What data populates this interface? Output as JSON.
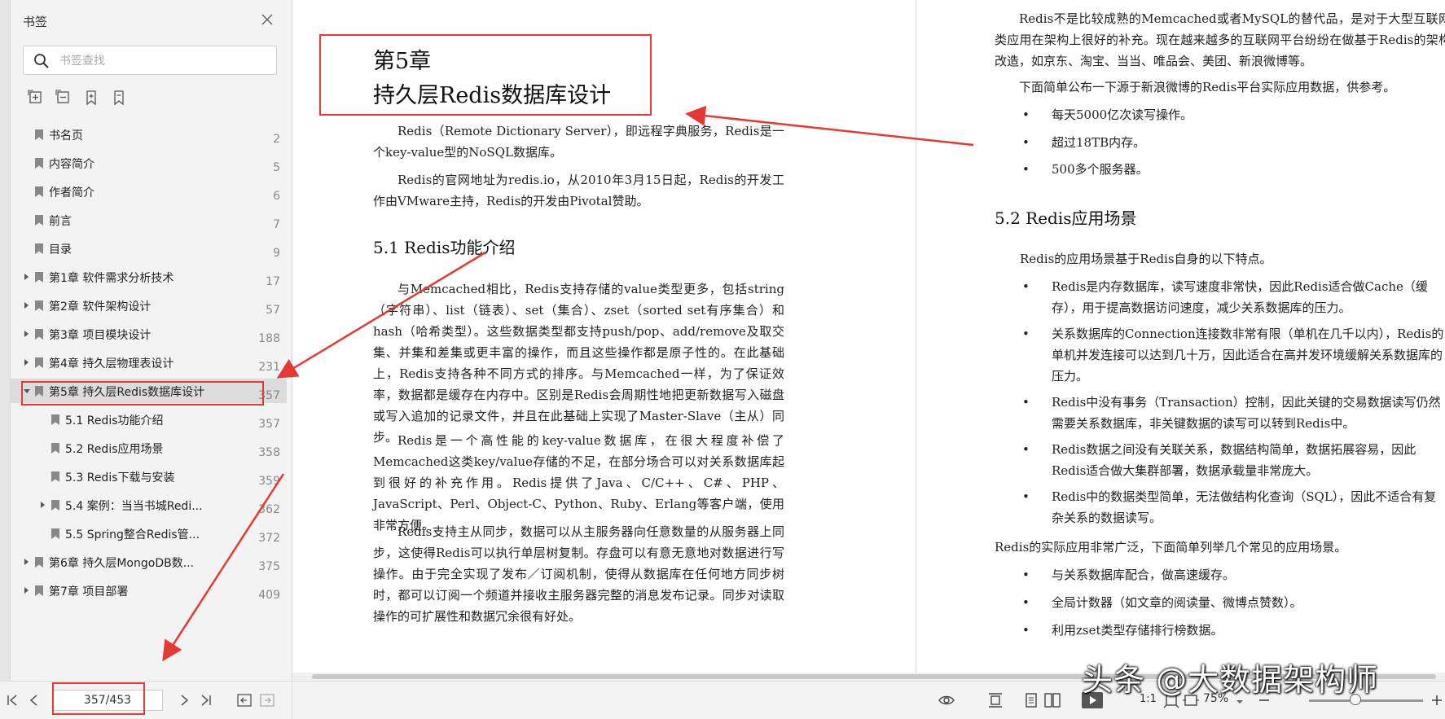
{
  "sidebar": {
    "title": "书签",
    "search_placeholder": "书签查找",
    "items": [
      {
        "label": "书名页",
        "page": "2"
      },
      {
        "label": "内容简介",
        "page": "5"
      },
      {
        "label": "作者简介",
        "page": "6"
      },
      {
        "label": "前言",
        "page": "7"
      },
      {
        "label": "目录",
        "page": "9"
      },
      {
        "label": "第1章 软件需求分析技术",
        "page": "17"
      },
      {
        "label": "第2章 软件架构设计",
        "page": "57"
      },
      {
        "label": "第3章 项目模块设计",
        "page": "188"
      },
      {
        "label": "第4章 持久层物理表设计",
        "page": "231"
      },
      {
        "label": "第5章 持久层Redis数据库设计",
        "page": "357"
      },
      {
        "label": "5.1 Redis功能介绍",
        "page": "357"
      },
      {
        "label": "5.2 Redis应用场景",
        "page": "358"
      },
      {
        "label": "5.3 Redis下载与安装",
        "page": "359"
      },
      {
        "label": "5.4 案例：当当书城Redi...",
        "page": "362"
      },
      {
        "label": "5.5 Spring整合Redis管...",
        "page": "372"
      },
      {
        "label": "第6章 持久层MongoDB数...",
        "page": "375"
      },
      {
        "label": "第7章 项目部署",
        "page": "409"
      }
    ]
  },
  "pager": {
    "value": "357/453"
  },
  "status": {
    "zoom": "75%",
    "actual_size": "1:1"
  },
  "left_page": {
    "chapter_line1": "第5章",
    "chapter_line2": "持久层Redis数据库设计",
    "p1": "Redis（Remote Dictionary Server），即远程字典服务，Redis是一个key-value型的NoSQL数据库。",
    "p2": "Redis的官网地址为redis.io，从2010年3月15日起，Redis的开发工作由VMware主持，Redis的开发由Pivotal赞助。",
    "h51": "5.1  Redis功能介绍",
    "p3": "与Memcached相比，Redis支持存储的value类型更多，包括string（字符串）、list（链表）、set（集合）、zset（sorted set有序集合）和hash（哈希类型）。这些数据类型都支持push/pop、add/remove及取交集、并集和差集或更丰富的操作，而且这些操作都是原子性的。在此基础上，Redis支持各种不同方式的排序。与Memcached一样，为了保证效率，数据都是缓存在内存中。区别是Redis会周期性地把更新数据写入磁盘或写入追加的记录文件，并且在此基础上实现了Master-Slave（主从）同步。",
    "p4": "Redis是一个高性能的key-value数据库，在很大程度补偿了Memcached这类key/value存储的不足，在部分场合可以对关系数据库起到很好的补充作用。Redis提供了Java、C/C++、C#、PHP、JavaScript、Perl、Object-C、Python、Ruby、Erlang等客户端，使用非常方便。",
    "p5": "Redis支持主从同步，数据可以从主服务器向任意数量的从服务器上同步，这使得Redis可以执行单层树复制。存盘可以有意无意地对数据进行写操作。由于完全实现了发布／订阅机制，使得从数据库在任何地方同步树时，都可以订阅一个频道并接收主服务器完整的消息发布记录。同步对读取操作的可扩展性和数据冗余很有好处。"
  },
  "right_page": {
    "p1": "Redis不是比较成熟的Memcached或者MySQL的替代品，是对于大型互联网类应用在架构上很好的补充。现在越来越多的互联网平台纷纷在做基于Redis的架构改造，如京东、淘宝、当当、唯品会、美团、新浪微博等。",
    "p2": "下面简单公布一下源于新浪微博的Redis平台实际应用数据，供参考。",
    "b1": "每天5000亿次读写操作。",
    "b2": "超过18TB内存。",
    "b3": "500多个服务器。",
    "h52": "5.2  Redis应用场景",
    "p3": "Redis的应用场景基于Redis自身的以下特点。",
    "b4": "Redis是内存数据库，读写速度非常快，因此Redis适合做Cache（缓存），用于提高数据访问速度，减少关系数据库的压力。",
    "b5": "关系数据库的Connection连接数非常有限（单机在几千以内），Redis的单机并发连接可以达到几十万，因此适合在高并发环境缓解关系数据库的压力。",
    "b6": "Redis中没有事务（Transaction）控制，因此关键的交易数据读写仍然需要关系数据库，非关键数据的读写可以转到Redis中。",
    "b7": "Redis数据之间没有关联关系，数据结构简单，数据拓展容易，因此Redis适合做大集群部署，数据承载量非常庞大。",
    "b8": "Redis中的数据类型简单，无法做结构化查询（SQL），因此不适合有复杂关系的数据读写。",
    "p4": "Redis的实际应用非常广泛，下面简单列举几个常见的应用场景。",
    "b9": "与关系数据库配合，做高速缓存。",
    "b10": "全局计数器（如文章的阅读量、微博点赞数）。",
    "b11": "利用zset类型存储排行榜数据。"
  },
  "watermark": "头条 @大数据架构师",
  "colors": {
    "annotation": "#e53935",
    "active_row": "#dcdcdc"
  }
}
